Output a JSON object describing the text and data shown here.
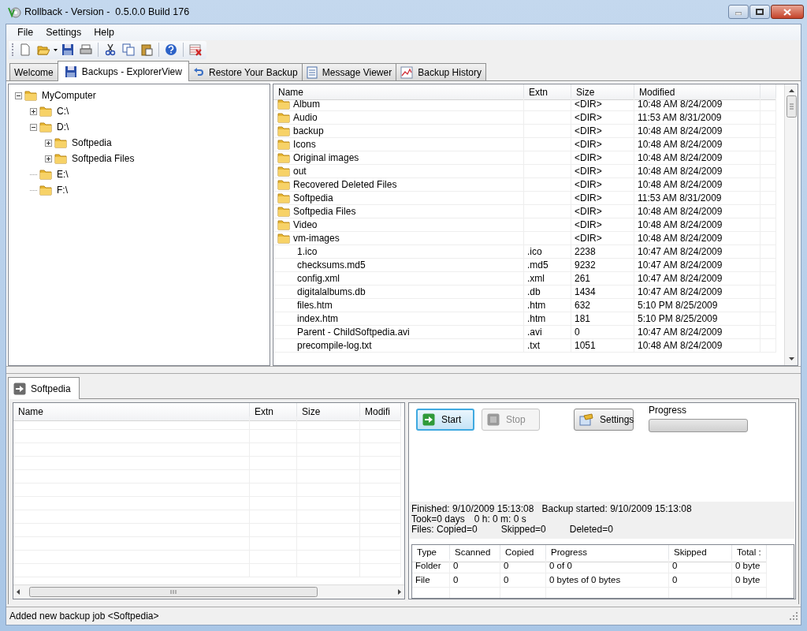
{
  "window": {
    "title": "Rollback - Version -  0.5.0.0 Build 176"
  },
  "menu": [
    "File",
    "Settings",
    "Help"
  ],
  "tabs": [
    {
      "label": "Welcome",
      "selected": false,
      "kind": "plain"
    },
    {
      "label": "Backups - ExplorerView",
      "selected": true,
      "kind": "disk"
    },
    {
      "label": "Restore Your Backup",
      "selected": false,
      "kind": "undo"
    },
    {
      "label": "Message Viewer",
      "selected": false,
      "kind": "document"
    },
    {
      "label": "Backup History",
      "selected": false,
      "kind": "chart"
    }
  ],
  "tree": [
    {
      "label": "MyComputer",
      "kind": "branch",
      "expanded": true,
      "children": [
        {
          "label": "C:\\",
          "kind": "branch",
          "expanded": false
        },
        {
          "label": "D:\\",
          "kind": "branch",
          "expanded": true,
          "children": [
            {
              "label": "Softpedia",
              "kind": "branch",
              "expanded": false
            },
            {
              "label": "Softpedia Files",
              "kind": "branch",
              "expanded": false
            }
          ]
        },
        {
          "label": "E:\\",
          "kind": "leaf"
        },
        {
          "label": "F:\\",
          "kind": "leaf"
        }
      ]
    }
  ],
  "file_list": {
    "columns": [
      "Name",
      "Extn",
      "Size",
      "Modified"
    ],
    "rows": [
      {
        "kind": "dir",
        "name": "Album",
        "extn": "",
        "size": "<DIR>",
        "modified": "10:48 AM 8/24/2009"
      },
      {
        "kind": "dir",
        "name": "Audio",
        "extn": "",
        "size": "<DIR>",
        "modified": "11:53 AM 8/31/2009"
      },
      {
        "kind": "dir",
        "name": "backup",
        "extn": "",
        "size": "<DIR>",
        "modified": "10:48 AM 8/24/2009"
      },
      {
        "kind": "dir",
        "name": "Icons",
        "extn": "",
        "size": "<DIR>",
        "modified": "10:48 AM 8/24/2009"
      },
      {
        "kind": "dir",
        "name": "Original images",
        "extn": "",
        "size": "<DIR>",
        "modified": "10:48 AM 8/24/2009"
      },
      {
        "kind": "dir",
        "name": "out",
        "extn": "",
        "size": "<DIR>",
        "modified": "10:48 AM 8/24/2009"
      },
      {
        "kind": "dir",
        "name": "Recovered Deleted Files",
        "extn": "",
        "size": "<DIR>",
        "modified": "10:48 AM 8/24/2009"
      },
      {
        "kind": "dir",
        "name": "Softpedia",
        "extn": "",
        "size": "<DIR>",
        "modified": "11:53 AM 8/31/2009"
      },
      {
        "kind": "dir",
        "name": "Softpedia Files",
        "extn": "",
        "size": "<DIR>",
        "modified": "10:48 AM 8/24/2009"
      },
      {
        "kind": "dir",
        "name": "Video",
        "extn": "",
        "size": "<DIR>",
        "modified": "10:48 AM 8/24/2009"
      },
      {
        "kind": "dir",
        "name": "vm-images",
        "extn": "",
        "size": "<DIR>",
        "modified": "10:48 AM 8/24/2009"
      },
      {
        "kind": "file",
        "name": "1.ico",
        "extn": ".ico",
        "size": "2238",
        "modified": "10:47 AM 8/24/2009"
      },
      {
        "kind": "file",
        "name": "checksums.md5",
        "extn": ".md5",
        "size": "9232",
        "modified": "10:47 AM 8/24/2009"
      },
      {
        "kind": "file",
        "name": "config.xml",
        "extn": ".xml",
        "size": "261",
        "modified": "10:47 AM 8/24/2009"
      },
      {
        "kind": "file",
        "name": "digitalalbums.db",
        "extn": ".db",
        "size": "1434",
        "modified": "10:47 AM 8/24/2009"
      },
      {
        "kind": "file",
        "name": "files.htm",
        "extn": ".htm",
        "size": "632",
        "modified": "5:10 PM 8/25/2009"
      },
      {
        "kind": "file",
        "name": "index.htm",
        "extn": ".htm",
        "size": "181",
        "modified": "5:10 PM 8/25/2009"
      },
      {
        "kind": "file",
        "name": "Parent - ChildSoftpedia.avi",
        "extn": ".avi",
        "size": "0",
        "modified": "10:47 AM 8/24/2009"
      },
      {
        "kind": "file",
        "name": "precompile-log.txt",
        "extn": ".txt",
        "size": "1051",
        "modified": "10:48 AM 8/24/2009"
      }
    ]
  },
  "job_tabs": [
    {
      "label": "Softpedia",
      "selected": true
    }
  ],
  "job_files": {
    "columns": [
      "Name",
      "Extn",
      "Size",
      "Modifi"
    ]
  },
  "buttons": [
    {
      "label": "Start",
      "kind": "start",
      "disabled": false,
      "focused": true
    },
    {
      "label": "Stop",
      "kind": "stop",
      "disabled": true,
      "focused": false
    },
    {
      "label": "Settings",
      "kind": "settings",
      "disabled": false,
      "focused": false
    }
  ],
  "progress": {
    "label": "Progress",
    "level": 0
  },
  "summary": [
    [
      "Finished: 9/10/2009 15:13:08",
      "Backup started: 9/10/2009 15:13:08"
    ],
    [
      "Took=0 days",
      "0 h: 0 m: 0 s"
    ],
    [
      "Files: Copied=0",
      "Skipped=0",
      "Deleted=0"
    ]
  ],
  "stats": {
    "columns": [
      "Type",
      "Scanned",
      "Copied",
      "Progress",
      "Skipped",
      "Total :"
    ],
    "rows": [
      [
        "Folder",
        "0",
        "0",
        "0 of 0",
        "0",
        "0 byte"
      ],
      [
        "File",
        "0",
        "0",
        "0 bytes of 0 bytes",
        "0",
        "0 byte"
      ]
    ]
  },
  "status_bar": "Added new backup job <Softpedia>"
}
